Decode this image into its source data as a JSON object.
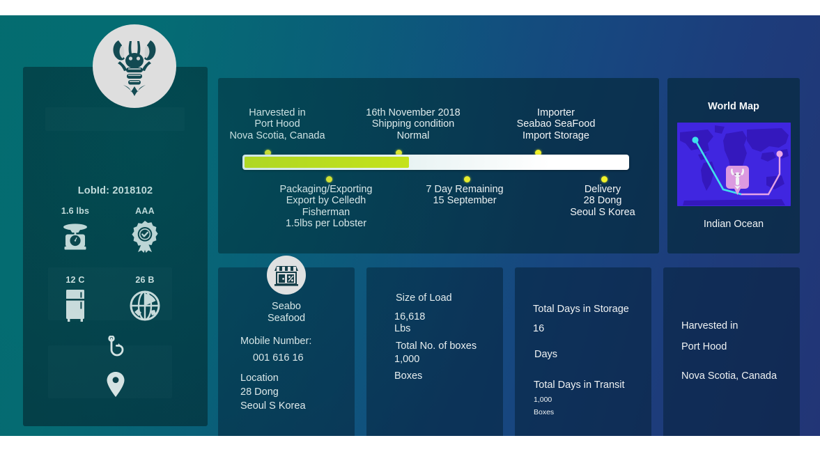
{
  "meta": {
    "lob_id_label": "LobId: 2018102",
    "accent_yellow": "#f2f22a",
    "progress_green": "#d7ed11",
    "panel_dark": "#042634"
  },
  "sidebar": {
    "logo_icon": "lobster-icon",
    "lob_id": "LobId: 2018102",
    "stats": [
      {
        "value": "1.6 lbs",
        "icon": "kitchen-scale-icon"
      },
      {
        "value": "AAA",
        "icon": "quality-badge-icon"
      },
      {
        "value": "12 C",
        "icon": "refrigerator-icon"
      },
      {
        "value": "26 B",
        "icon": "globe-grid-icon"
      }
    ],
    "hook_icon": "fishing-hook-icon",
    "location_pin_icon": "map-pin-icon"
  },
  "timeline": {
    "progress_percent": 43,
    "above_steps": [
      {
        "lines": [
          "Harvested in",
          "Port Hood",
          "Nova Scotia, Canada"
        ],
        "dot_percent": 6
      },
      {
        "lines": [
          "16th November 2018",
          "Shipping condition",
          "Normal"
        ],
        "dot_percent": 40
      },
      {
        "lines": [
          "Importer",
          "Seabao SeaFood",
          "Import Storage"
        ],
        "dot_percent": 76
      }
    ],
    "below_steps": [
      {
        "lines": [
          "Packaging/Exporting",
          "Export by Celledh",
          "Fisherman",
          "1.5lbs per Lobster"
        ],
        "dot_percent": 22
      },
      {
        "lines": [
          "7 Day Remaining",
          "15 September"
        ],
        "dot_percent": 57
      },
      {
        "lines": [
          "Delivery",
          "28 Dong",
          "Seoul S Korea"
        ],
        "dot_percent": 92
      }
    ]
  },
  "world_map": {
    "title": "World Map",
    "caption": "Indian Ocean",
    "map_icon": "world-map-image",
    "origin_marker_color": "#3de0ec",
    "destination_marker_color": "#eeaae8",
    "lobster_marker_icon": "lobster-marker-icon"
  },
  "cards": {
    "vendor": {
      "icon": "storefront-icon",
      "name_lines": [
        "Seabo",
        "Seafood"
      ],
      "mobile_label": "Mobile Number:",
      "mobile_value": "001 616 16",
      "location_label": "Location",
      "location_lines": [
        "28 Dong",
        "Seoul S Korea"
      ]
    },
    "load": {
      "size_label": "Size of Load",
      "size_value": "16,618",
      "size_unit": "Lbs",
      "boxes_label": "Total No. of boxes",
      "boxes_value": "1,000",
      "boxes_unit": "Boxes"
    },
    "days": {
      "storage_label": "Total Days in Storage",
      "storage_value": "16",
      "storage_unit": "Days",
      "transit_label": "Total Days in Transit",
      "transit_value": "1,000",
      "transit_unit": "Boxes"
    },
    "harvest": {
      "label": "Harvested in",
      "place": "Port Hood",
      "region": "Nova Scotia, Canada"
    }
  }
}
